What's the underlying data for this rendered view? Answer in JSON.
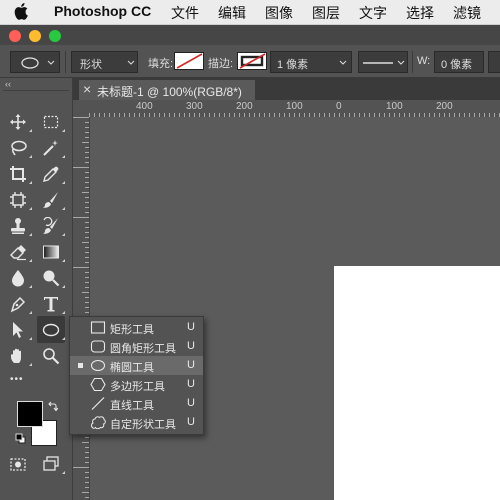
{
  "menubar": {
    "app_name": "Photoshop CC",
    "items": [
      "文件",
      "编辑",
      "图像",
      "图层",
      "文字",
      "选择",
      "滤镜"
    ]
  },
  "window": {
    "traffic_lights": [
      "#ff5f57",
      "#febc2e",
      "#28c840"
    ]
  },
  "options_bar": {
    "mode_value": "形状",
    "fill_label": "填充:",
    "stroke_label": "描边:",
    "stroke_width_value": "1 像素",
    "width_label": "W:",
    "width_value": "0 像素"
  },
  "document": {
    "tab_title": "未标题-1 @ 100%(RGB/8*)"
  },
  "rulers": {
    "h_labels": [
      "400",
      "300",
      "200",
      "100",
      "0",
      "100",
      "200"
    ]
  },
  "toolbar": {
    "collapse_glyph": "‹‹",
    "more_tools_glyph": "•••",
    "foreground_color": "#000000",
    "background_color": "#ffffff"
  },
  "flyout": {
    "items": [
      {
        "icon": "rectangle-tool-icon",
        "label": "矩形工具",
        "shortcut": "U",
        "selected": false
      },
      {
        "icon": "rounded-rectangle-tool-icon",
        "label": "圆角矩形工具",
        "shortcut": "U",
        "selected": false
      },
      {
        "icon": "ellipse-tool-icon",
        "label": "椭圆工具",
        "shortcut": "U",
        "selected": true
      },
      {
        "icon": "polygon-tool-icon",
        "label": "多边形工具",
        "shortcut": "U",
        "selected": false
      },
      {
        "icon": "line-tool-icon",
        "label": "直线工具",
        "shortcut": "U",
        "selected": false
      },
      {
        "icon": "custom-shape-tool-icon",
        "label": "自定形状工具",
        "shortcut": "U",
        "selected": false
      }
    ]
  },
  "colors": {
    "panel": "#535353",
    "canvas_bg": "#5b5b5b",
    "menu_selected": "#6a6a6a"
  }
}
